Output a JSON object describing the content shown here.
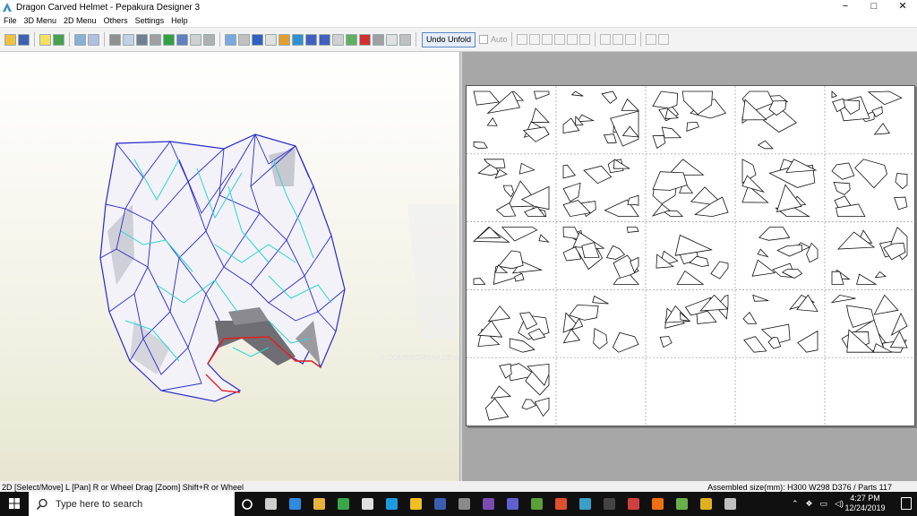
{
  "window": {
    "title": "Dragon Carved Helmet - Pepakura Designer 3",
    "controls": {
      "minimize": "−",
      "maximize": "□",
      "close": "✕"
    }
  },
  "menu": [
    "File",
    "3D Menu",
    "2D Menu",
    "Others",
    "Settings",
    "Help"
  ],
  "toolbar": {
    "undo_unfold_label": "Undo Unfold",
    "auto_label": "Auto"
  },
  "watermark": "© ZOMBIEGRIMM.DEVIANTART.COM",
  "status": {
    "left": "2D [Select/Move] L [Pan] R or Wheel Drag [Zoom] Shift+R or Wheel",
    "right": "Assembled size(mm): H300 W298 D376 / Parts 117"
  },
  "taskbar": {
    "search_placeholder": "Type here to search",
    "time": "4:27 PM",
    "date": "12/24/2019",
    "apps": [
      {
        "icon": "task-view-icon",
        "color": "#cfcfcf"
      },
      {
        "icon": "edge-icon",
        "color": "#2f8be0"
      },
      {
        "icon": "file-explorer-icon",
        "color": "#e8b33a"
      },
      {
        "icon": "green-app-icon",
        "color": "#3aa64a"
      },
      {
        "icon": "store-icon",
        "color": "#e0e0e0"
      },
      {
        "icon": "ie-icon",
        "color": "#1b9be0"
      },
      {
        "icon": "yellow-app-icon",
        "color": "#f0c020"
      },
      {
        "icon": "wordpad-icon",
        "color": "#3a5fb0"
      },
      {
        "icon": "utility-icon",
        "color": "#8a8a8a"
      },
      {
        "icon": "media-icon",
        "color": "#7b4bb0"
      },
      {
        "icon": "network-icon",
        "color": "#6060d0"
      },
      {
        "icon": "game-icon",
        "color": "#5a9f3a"
      },
      {
        "icon": "orange-app-icon",
        "color": "#e05030"
      },
      {
        "icon": "pepakura-icon",
        "color": "#3aa0c8"
      },
      {
        "icon": "calculator-icon",
        "color": "#444444"
      },
      {
        "icon": "paint-icon",
        "color": "#d04040"
      },
      {
        "icon": "cone-icon",
        "color": "#f07010"
      },
      {
        "icon": "green-leaf-icon",
        "color": "#6ab04a"
      },
      {
        "icon": "chrome-icon",
        "color": "#e0b020"
      },
      {
        "icon": "tool-icon",
        "color": "#c0c0c0"
      }
    ]
  },
  "tray_icons": [
    "chevron-up-icon",
    "dropbox-icon",
    "battery-icon",
    "volume-icon"
  ],
  "colors": {
    "accent": "#0078d7",
    "mesh_blue": "#2a2acc",
    "mesh_cyan": "#2ad5d5",
    "mesh_red": "#e02020"
  }
}
